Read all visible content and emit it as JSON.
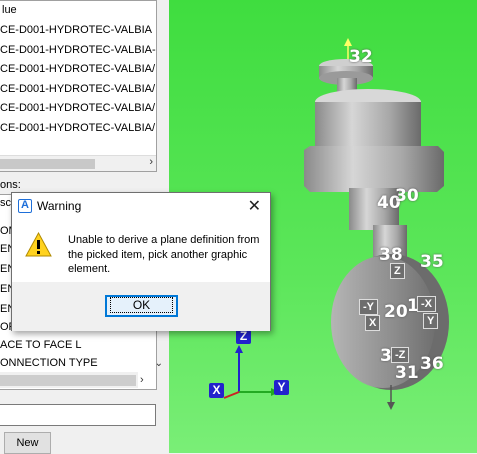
{
  "left_panel": {
    "list_header": "lue",
    "items": [
      "CE-D001-HYDROTEC-VALBIA",
      "CE-D001-HYDROTEC-VALBIA-",
      "CE-D001-HYDROTEC-VALBIA/",
      "CE-D001-HYDROTEC-VALBIA/",
      "CE-D001-HYDROTEC-VALBIA/",
      "CE-D001-HYDROTEC-VALBIA/"
    ],
    "section_label": "ons:",
    "list2_items": [
      "sc",
      "OM",
      "EN",
      "EN",
      "EN",
      "EN",
      "OP",
      "ACE TO FACE L",
      "ONNECTION TYPE"
    ],
    "new_button": "New"
  },
  "dialog": {
    "title": "Warning",
    "message": "Unable to derive a plane definition from the picked item, pick another graphic element.",
    "ok_label": "OK",
    "close_glyph": "✕"
  },
  "viewport": {
    "labels": [
      "32",
      "40",
      "30",
      "38",
      "35",
      "20",
      "1",
      "3",
      "31",
      "36"
    ],
    "tags": [
      "Z",
      "-Y",
      "X",
      "-X",
      "Y",
      "-Z"
    ],
    "axes": {
      "z": "Z",
      "x": "X",
      "y": "Y"
    },
    "colors": {
      "background": "#4de04b",
      "axis_z": "#2222cc",
      "axis_x": "#cc2222",
      "axis_y": "#22aa22"
    }
  }
}
